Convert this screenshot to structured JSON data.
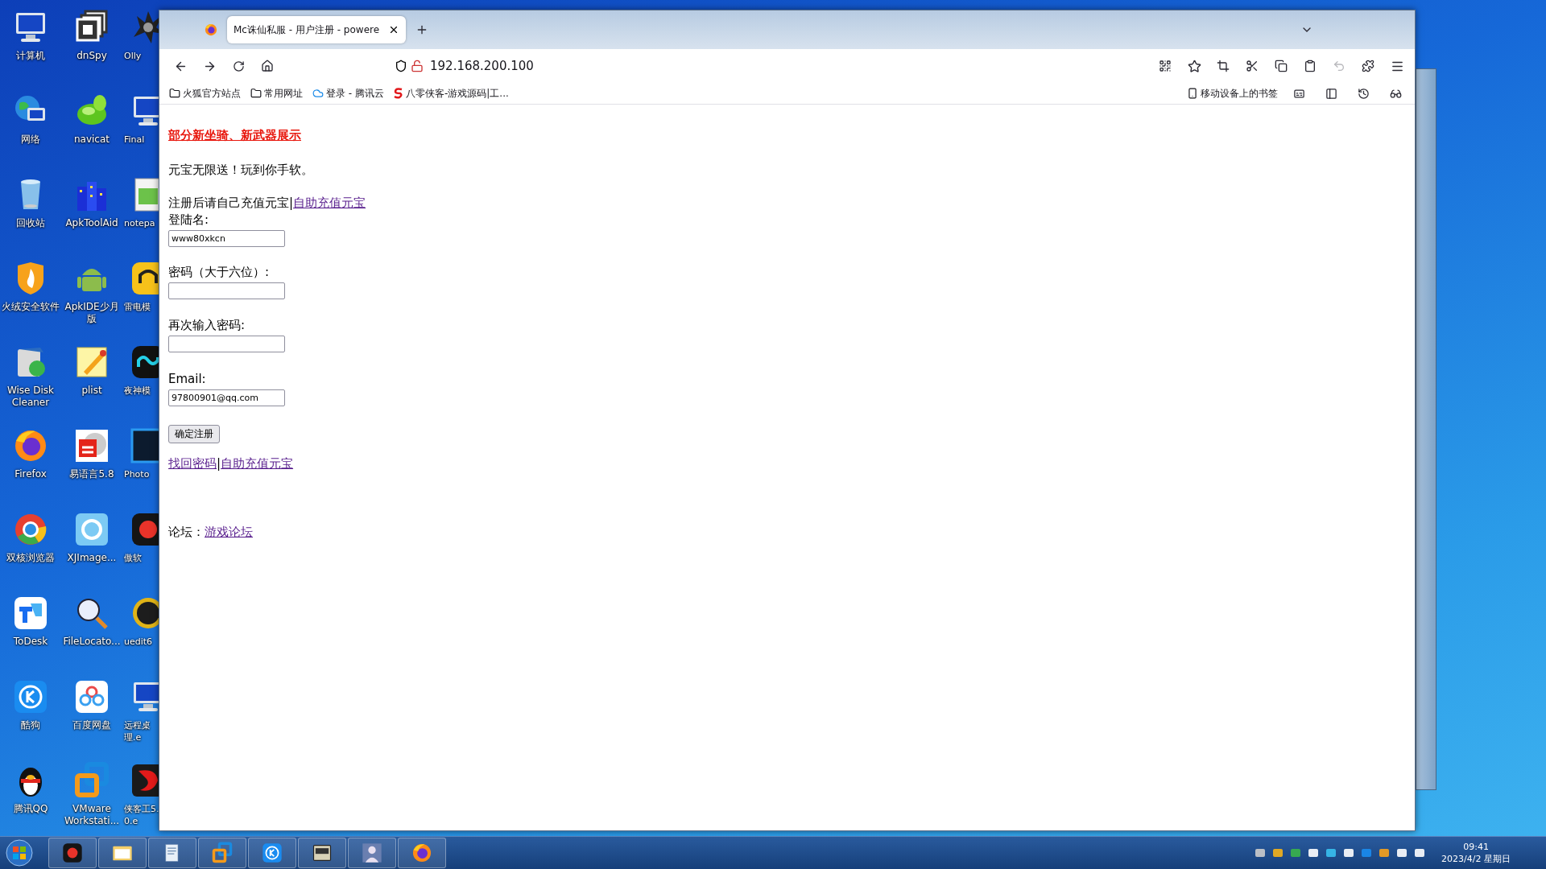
{
  "desktop": {
    "icons": [
      {
        "label": "计算机"
      },
      {
        "label": "dnSpy"
      },
      {
        "label": "Olly"
      },
      {
        "label": "网络"
      },
      {
        "label": "navicat"
      },
      {
        "label": "Final"
      },
      {
        "label": "回收站"
      },
      {
        "label": "ApkToolAid"
      },
      {
        "label": "notepa"
      },
      {
        "label": "火绒安全软件"
      },
      {
        "label": "ApkIDE少月版"
      },
      {
        "label": "雷电模"
      },
      {
        "label": "Wise Disk Cleaner"
      },
      {
        "label": "plist"
      },
      {
        "label": "夜神模"
      },
      {
        "label": "Firefox"
      },
      {
        "label": "易语言5.8"
      },
      {
        "label": "Photo"
      },
      {
        "label": "双核浏览器"
      },
      {
        "label": "XJImage..."
      },
      {
        "label": "傲软"
      },
      {
        "label": "ToDesk"
      },
      {
        "label": "FileLocato..."
      },
      {
        "label": "uedit6"
      },
      {
        "label": "酷狗"
      },
      {
        "label": "百度网盘"
      },
      {
        "label": "远程桌理.e"
      },
      {
        "label": "腾讯QQ"
      },
      {
        "label": "VMware Workstati..."
      },
      {
        "label": "侠客工5.0.e"
      }
    ]
  },
  "browser": {
    "tabs": [
      {
        "kind": "pinned",
        "selected": false
      },
      {
        "kind": "page",
        "title": "Mc诛仙私服 - 用户注册 - powere",
        "selected": true
      }
    ],
    "url": "192.168.200.100",
    "bookmarks": [
      {
        "kind": "folder",
        "label": "火狐官方站点"
      },
      {
        "kind": "folder",
        "label": "常用网址"
      },
      {
        "kind": "cloud",
        "label": "登录 - 腾讯云"
      },
      {
        "kind": "logo",
        "label": "八零侠客-游戏源码|工..."
      }
    ],
    "mobile_bookmarks": "移动设备上的书签"
  },
  "page": {
    "promo_link": "部分新坐骑、新武器展示",
    "slogan": "元宝无限送！玩到你手软。",
    "notice": "注册后请自己充值元宝|",
    "notice_link": "自助充值元宝",
    "fields": [
      {
        "label": "登陆名:",
        "value": "www80xkcn"
      },
      {
        "label": "密码（大于六位）:"
      },
      {
        "label": "再次输入密码:"
      },
      {
        "label": "Email:",
        "value": "97800901@qq.com"
      }
    ],
    "submit": "确定注册",
    "links": [
      {
        "text": "找回密码"
      },
      {
        "text": "自助充值元宝"
      }
    ],
    "separator": "|",
    "forum_label": "论坛：",
    "forum_link": "游戏论坛"
  },
  "taskbar": {
    "time": "09:41",
    "date": "2023/4/2 星期日"
  }
}
